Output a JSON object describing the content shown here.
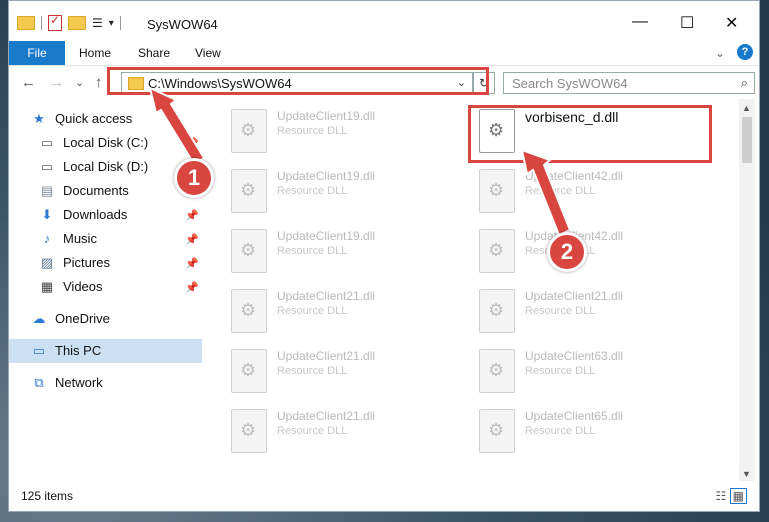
{
  "window": {
    "title": "SysWOW64",
    "minimize": "—",
    "maximize": "☐",
    "close": "✕"
  },
  "ribbon": {
    "file": "File",
    "tabs": [
      "Home",
      "Share",
      "View"
    ],
    "collapse": "⌄",
    "help": "?"
  },
  "nav": {
    "back": "←",
    "forward": "→",
    "recent": "⌄",
    "up": "↑"
  },
  "address": {
    "path": "C:\\Windows\\SysWOW64",
    "dropdown": "⌄",
    "refresh": "↻"
  },
  "search": {
    "placeholder": "Search SysWOW64",
    "icon": "search-icon"
  },
  "sidebar": {
    "quick_access": "Quick access",
    "items": [
      {
        "label": "Local Disk (C:)",
        "icon": "drive-icon",
        "pinned": true
      },
      {
        "label": "Local Disk (D:)",
        "icon": "drive-icon",
        "pinned": false
      },
      {
        "label": "Documents",
        "icon": "documents-icon",
        "pinned": true
      },
      {
        "label": "Downloads",
        "icon": "downloads-icon",
        "pinned": true
      },
      {
        "label": "Music",
        "icon": "music-icon",
        "pinned": true
      },
      {
        "label": "Pictures",
        "icon": "pictures-icon",
        "pinned": true
      },
      {
        "label": "Videos",
        "icon": "videos-icon",
        "pinned": true
      }
    ],
    "onedrive": "OneDrive",
    "this_pc": "This PC",
    "network": "Network"
  },
  "files": [
    {
      "name": "UpdateClient19.dll",
      "type": "Resource DLL"
    },
    {
      "name": "vorbisenc_d.dll",
      "type": ""
    },
    {
      "name": "UpdateClient19.dll",
      "type": "Resource DLL"
    },
    {
      "name": "UpdateClient42.dll",
      "type": "Resource DLL"
    },
    {
      "name": "UpdateClient19.dll",
      "type": "Resource DLL"
    },
    {
      "name": "UpdateClient42.dll",
      "type": "Resource DLL"
    },
    {
      "name": "UpdateClient21.dll",
      "type": "Resource DLL"
    },
    {
      "name": "UpdateClient21.dll",
      "type": "Resource DLL"
    },
    {
      "name": "UpdateClient21.dll",
      "type": "Resource DLL"
    },
    {
      "name": "UpdateClient63.dll",
      "type": "Resource DLL"
    },
    {
      "name": "UpdateClient21.dll",
      "type": "Resource DLL"
    },
    {
      "name": "UpdateClient65.dll",
      "type": "Resource DLL"
    }
  ],
  "status": {
    "count": "125 items"
  },
  "callouts": {
    "one": "1",
    "two": "2"
  },
  "colors": {
    "accent": "#1979ca",
    "highlight": "#d9453f",
    "selected": "#cce0f4"
  }
}
